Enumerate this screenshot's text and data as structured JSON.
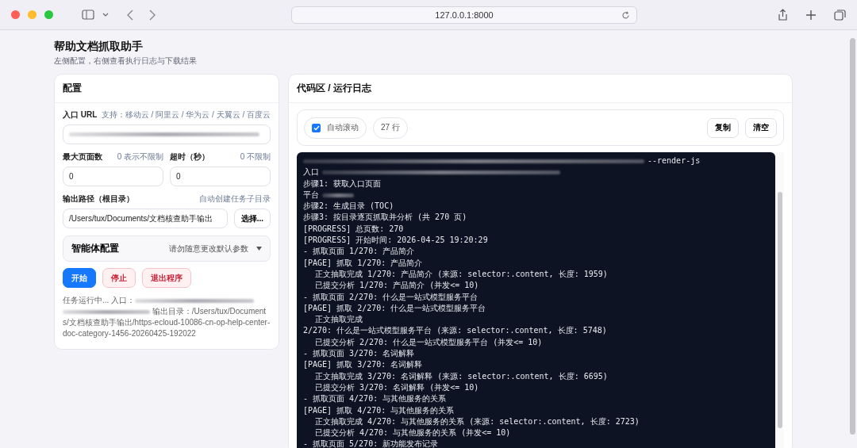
{
  "browser": {
    "url": "127.0.0.1:8000"
  },
  "header": {
    "title": "帮助文档抓取助手",
    "subtitle": "左侧配置，右侧查看执行日志与下载结果"
  },
  "config": {
    "title": "配置",
    "entry": {
      "label": "入口 URL",
      "hint": "支持：移动云 / 阿里云 / 华为云 / 天翼云 / 百度云"
    },
    "max_pages": {
      "label": "最大页面数",
      "hint": "0 表示不限制",
      "value": "0"
    },
    "timeout": {
      "label": "超时（秒）",
      "hint": "0 不限制",
      "value": "0"
    },
    "output": {
      "label": "输出路径（根目录）",
      "hint": "自动创建任务子目录",
      "value": "/Users/tux/Documents/文档核查助手输出",
      "button": "选择..."
    },
    "agent": {
      "title": "智能体配置",
      "hint": "请勿随意更改默认参数",
      "expanded": false
    },
    "buttons": [
      {
        "label": "开始",
        "kind": "primary"
      },
      {
        "label": "停止",
        "kind": "danger"
      },
      {
        "label": "退出程序",
        "kind": "danger"
      }
    ],
    "status": {
      "prefix": "任务运行中... 入口：",
      "suffix": "输出目录：/Users/tux/Documents/文档核查助手输出/https-ecloud-10086-cn-op-help-center-doc-category-1456-20260425-192022"
    }
  },
  "log": {
    "title": "代码区 / 运行日志",
    "autoscroll": {
      "label": "自动滚动",
      "checked": true
    },
    "count": "27 行",
    "buttons": [
      "复制",
      "清空"
    ],
    "lines": [
      {
        "kind": "lead",
        "text": "--render-js"
      },
      {
        "kind": "tail",
        "text": "入口"
      },
      {
        "kind": "plain",
        "text": "步骤1: 获取入口页面"
      },
      {
        "kind": "stub",
        "text": "平台"
      },
      {
        "kind": "plain",
        "text": "步骤2: 生成目录 (TOC)"
      },
      {
        "kind": "plain",
        "text": "步骤3: 按目录逐页抓取并分析 (共 270 页)"
      },
      {
        "kind": "plain",
        "text": "[PROGRESS] 总页数: 270"
      },
      {
        "kind": "plain",
        "text": "[PROGRESS] 开始时间: 2026-04-25 19:20:29"
      },
      {
        "kind": "plain",
        "text": "- 抓取页面 1/270: 产品简介"
      },
      {
        "kind": "plain",
        "text": "[PAGE] 抓取 1/270: 产品简介"
      },
      {
        "kind": "indented",
        "text": "正文抽取完成 1/270: 产品简介 (来源: selector:.content, 长度: 1959)"
      },
      {
        "kind": "indented",
        "text": "已提交分析 1/270: 产品简介 (并发<= 10)"
      },
      {
        "kind": "plain",
        "text": "- 抓取页面 2/270: 什么是一站式模型服务平台"
      },
      {
        "kind": "plain",
        "text": "[PAGE] 抓取 2/270: 什么是一站式模型服务平台"
      },
      {
        "kind": "indented",
        "text": "正文抽取完成"
      },
      {
        "kind": "plain",
        "text": "2/270: 什么是一站式模型服务平台 (来源: selector:.content, 长度: 5748)"
      },
      {
        "kind": "indented",
        "text": "已提交分析 2/270: 什么是一站式模型服务平台 (并发<= 10)"
      },
      {
        "kind": "plain",
        "text": "- 抓取页面 3/270: 名词解释"
      },
      {
        "kind": "plain",
        "text": "[PAGE] 抓取 3/270: 名词解释"
      },
      {
        "kind": "indented",
        "text": "正文抽取完成 3/270: 名词解释 (来源: selector:.content, 长度: 6695)"
      },
      {
        "kind": "indented",
        "text": "已提交分析 3/270: 名词解释 (并发<= 10)"
      },
      {
        "kind": "plain",
        "text": "- 抓取页面 4/270: 与其他服务的关系"
      },
      {
        "kind": "plain",
        "text": "[PAGE] 抓取 4/270: 与其他服务的关系"
      },
      {
        "kind": "indented",
        "text": "正文抽取完成 4/270: 与其他服务的关系 (来源: selector:.content, 长度: 2723)"
      },
      {
        "kind": "indented",
        "text": "已提交分析 4/270: 与其他服务的关系 (并发<= 10)"
      },
      {
        "kind": "plain",
        "text": "- 抓取页面 5/270: 新功能发布记录"
      }
    ]
  }
}
